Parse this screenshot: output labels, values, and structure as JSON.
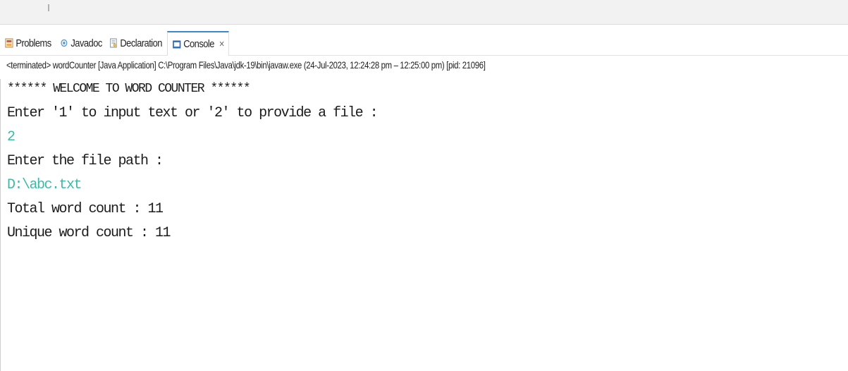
{
  "tabs": [
    {
      "label": "Problems",
      "icon": "problems-icon",
      "active": false
    },
    {
      "label": "Javadoc",
      "icon": "javadoc-icon",
      "active": false
    },
    {
      "label": "Declaration",
      "icon": "declaration-icon",
      "active": false
    },
    {
      "label": "Console",
      "icon": "console-icon",
      "active": true,
      "close": "×"
    }
  ],
  "status": "<terminated> wordCounter [Java Application] C:\\Program Files\\Java\\jdk-19\\bin\\javaw.exe  (24-Jul-2023, 12:24:28 pm – 12:25:00 pm) [pid: 21096]",
  "console": {
    "lines": [
      "****** WELCOME TO WORD COUNTER ******",
      "Enter '1' to input text or '2' to provide a file :",
      "2",
      "Enter the file path :",
      "D:\\abc.txt",
      "Total word count : 11",
      "Unique word count : 11"
    ]
  },
  "colors": {
    "input_text": "#3fb9a6",
    "active_tab_accent": "#3a87d4"
  }
}
